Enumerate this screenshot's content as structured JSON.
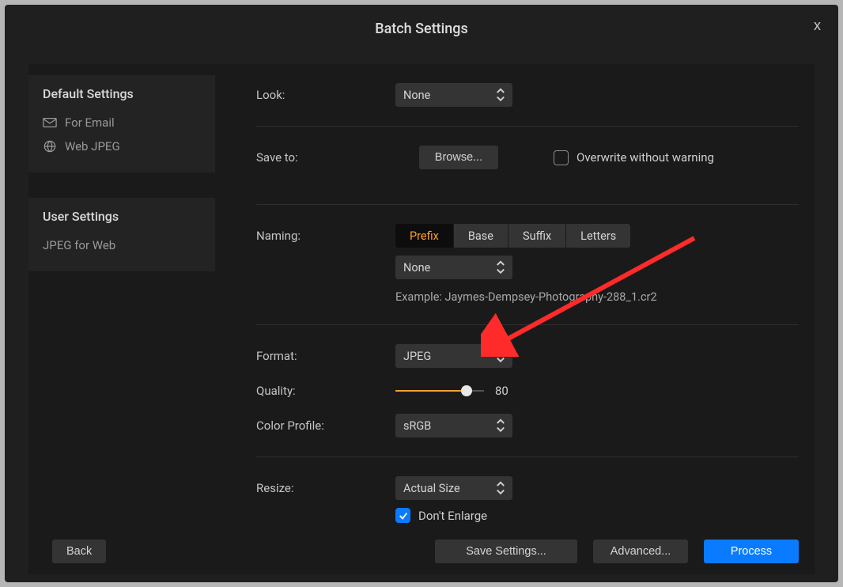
{
  "title": "Batch Settings",
  "sidebar": {
    "default": {
      "title": "Default Settings",
      "items": [
        {
          "label": "For Email"
        },
        {
          "label": "Web JPEG"
        }
      ]
    },
    "user": {
      "title": "User Settings",
      "items": [
        {
          "label": "JPEG for Web"
        }
      ]
    }
  },
  "look": {
    "label": "Look:",
    "value": "None"
  },
  "saveTo": {
    "label": "Save to:",
    "browse": "Browse...",
    "overwrite": "Overwrite without warning"
  },
  "naming": {
    "label": "Naming:",
    "segments": {
      "prefix": "Prefix",
      "base": "Base",
      "suffix": "Suffix",
      "letters": "Letters"
    },
    "value": "None",
    "example": "Example: Jaymes-Dempsey-Photography-288_1.cr2"
  },
  "format": {
    "label": "Format:",
    "value": "JPEG"
  },
  "quality": {
    "label": "Quality:",
    "value": 80
  },
  "colorProfile": {
    "label": "Color Profile:",
    "value": "sRGB"
  },
  "resize": {
    "label": "Resize:",
    "value": "Actual Size",
    "dontEnlarge": "Don't Enlarge"
  },
  "buttons": {
    "back": "Back",
    "saveSettings": "Save Settings...",
    "advanced": "Advanced...",
    "process": "Process"
  }
}
